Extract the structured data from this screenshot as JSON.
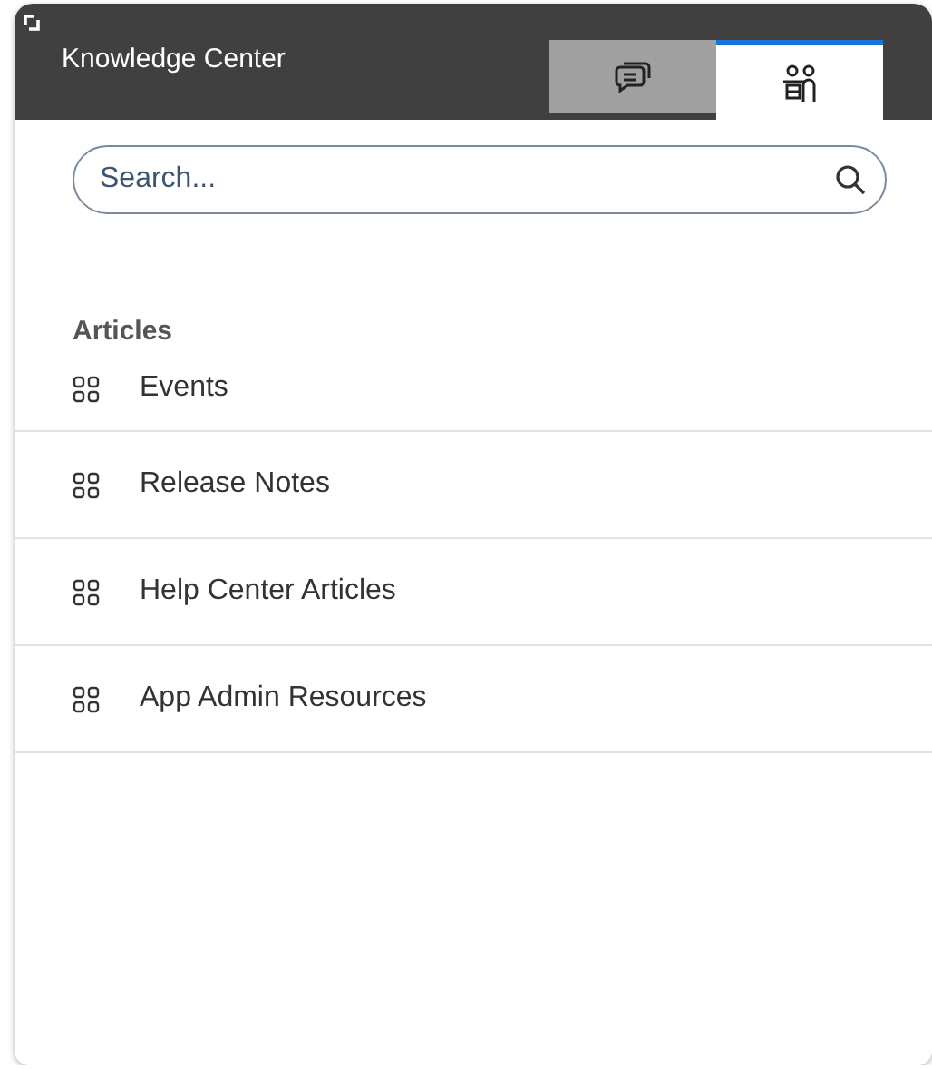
{
  "header": {
    "title": "Knowledge Center"
  },
  "tabs": [
    {
      "kind": "chat",
      "selected": false
    },
    {
      "kind": "people",
      "selected": true
    }
  ],
  "search": {
    "placeholder": "Search..."
  },
  "section": {
    "title": "Articles"
  },
  "items": [
    {
      "label": "Events"
    },
    {
      "label": "Release Notes"
    },
    {
      "label": "Help Center Articles"
    },
    {
      "label": "App Admin Resources"
    }
  ]
}
